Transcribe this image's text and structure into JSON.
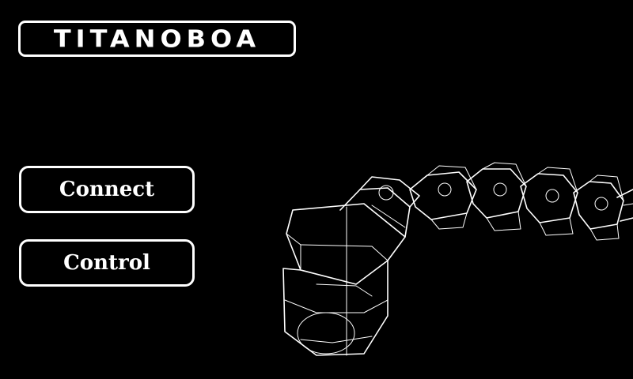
{
  "app": {
    "logo_text": "TITANOBOA"
  },
  "menu": {
    "connect_label": "Connect",
    "control_label": "Control"
  },
  "colors": {
    "background": "#000000",
    "foreground": "#ffffff"
  }
}
